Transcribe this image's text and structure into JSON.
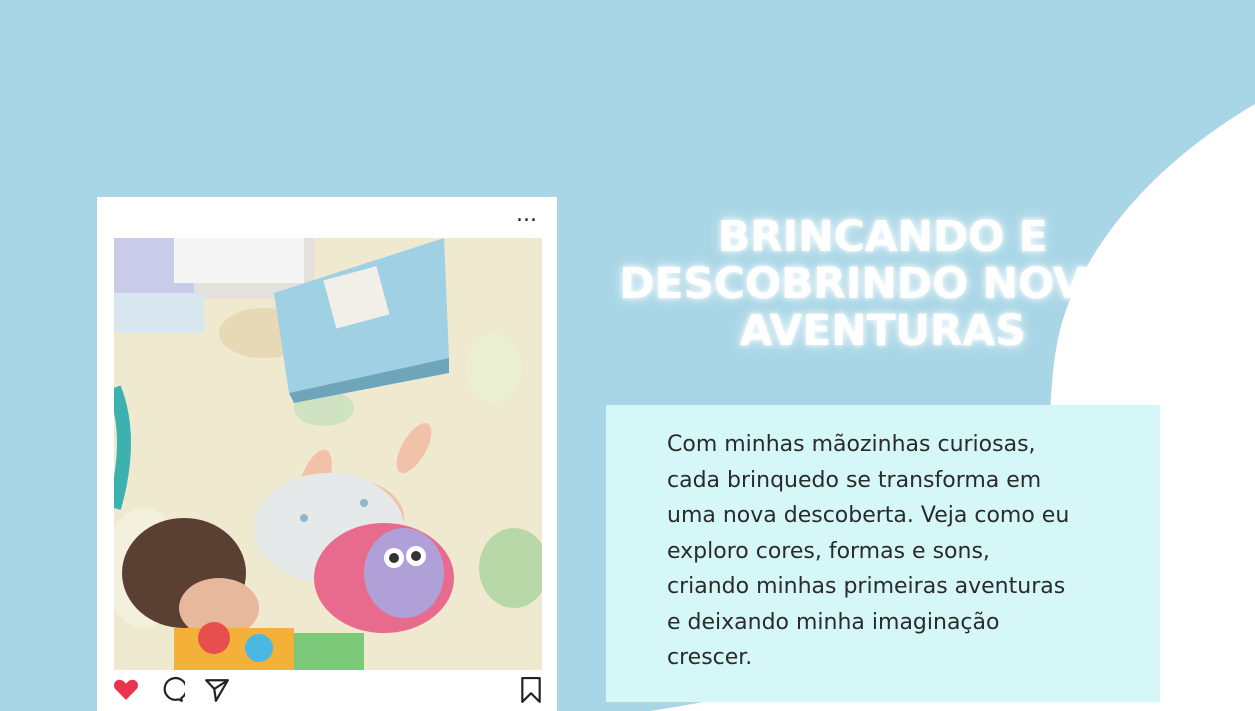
{
  "post": {
    "more_label": "...",
    "photo_alt": "Bebê brincando no tapete",
    "actions": {
      "like_icon": "heart-filled-icon",
      "comment_icon": "comment-icon",
      "share_icon": "paper-plane-icon",
      "save_icon": "bookmark-icon"
    },
    "like_color": "#e8354d"
  },
  "content": {
    "title": "BRINCANDO E DESCOBRINDO NOVAS AVENTURAS",
    "description": "Com minhas mãozinhas curiosas,\ncada brinquedo se transforma em\numa nova descoberta. Veja como eu\nexploro cores, formas e sons,\ncriando minhas primeiras aventuras\ne deixando minha imaginação\ncrescer."
  },
  "colors": {
    "background": "#a8d6e6",
    "wave": "#ffffff",
    "text_box": "#d5f7f7",
    "title": "#ffffff"
  }
}
